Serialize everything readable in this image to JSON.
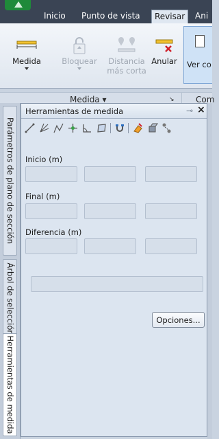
{
  "ribbon": {
    "tabs": [
      {
        "label": "Inicio",
        "active": false
      },
      {
        "label": "Punto de vista",
        "active": false
      },
      {
        "label": "Revisar",
        "active": true
      },
      {
        "label": "Ani",
        "active": false
      }
    ],
    "buttons": {
      "medida": {
        "label": "Medida",
        "icon": "ruler-icon"
      },
      "bloquear": {
        "label": "Bloquear",
        "icon": "lock-icon"
      },
      "distancia_line1": "Distancia",
      "distancia_line2": "más corta",
      "anular": {
        "label": "Anular",
        "icon": "clear-measure-icon"
      },
      "ver": {
        "label": "Ver co"
      }
    },
    "groups": {
      "medida_label": "Medida ▾",
      "launcher": "↘",
      "next_label": "Com"
    }
  },
  "side_tabs": [
    {
      "label": "Parámetros de plano de sección"
    },
    {
      "label": "Árbol de selección"
    },
    {
      "label": "Herramientas de medida"
    }
  ],
  "panel": {
    "title": "Herramientas de medida",
    "pin_icon": "pin-icon",
    "close": "×",
    "tools": [
      "point-to-point-icon",
      "point-to-multiple-points-icon",
      "point-line-icon",
      "accumulate-icon",
      "angle-icon",
      "area-icon",
      "lock-icon",
      "clear-icon",
      "transform-icon",
      "shortest-distance-icon"
    ],
    "inicio_label": "Inicio (m)",
    "final_label": "Final (m)",
    "diferencia_label": "Diferencia (m)",
    "inicio_values": [
      "",
      "",
      ""
    ],
    "final_values": [
      "",
      "",
      ""
    ],
    "diferencia_values": [
      "",
      "",
      ""
    ],
    "distance_value": "",
    "options_button": "Opciones..."
  },
  "colors": {
    "ribbon_dark": "#3a4454",
    "panel_bg": "#dce5f0",
    "app_green": "#1f8a3a"
  }
}
